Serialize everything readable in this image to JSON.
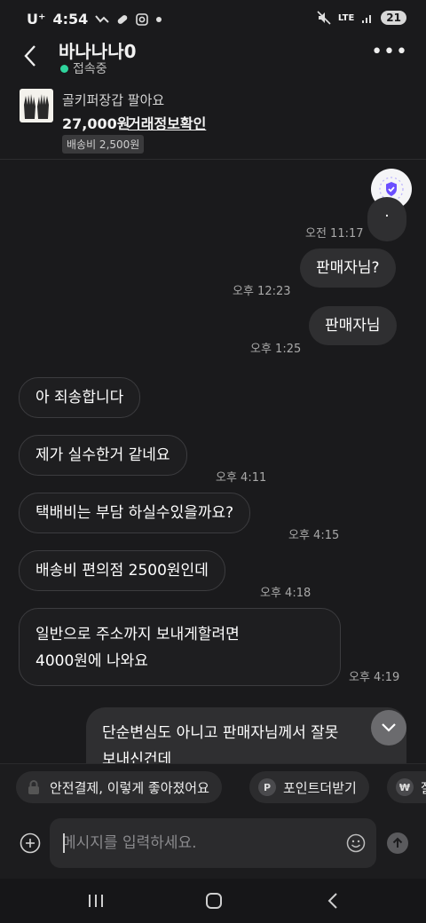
{
  "status_bar": {
    "carrier": "U⁺",
    "time": "4:54",
    "network": "LTE",
    "battery": "21"
  },
  "header": {
    "title": "바나나나0",
    "status": "접속중"
  },
  "product": {
    "name": "골키퍼장갑 팔아요",
    "price": "27,000원",
    "link": "거래정보확인",
    "shipping": "배송비 2,500원"
  },
  "messages": [
    {
      "side": "mine",
      "text": "·",
      "time": "오전 11:17"
    },
    {
      "side": "mine",
      "text": "판매자님?",
      "time": "오후 12:23"
    },
    {
      "side": "mine",
      "text": "판매자님",
      "time": "오후 1:25"
    },
    {
      "side": "theirs",
      "text": "아 죄송합니다",
      "time": ""
    },
    {
      "side": "theirs",
      "text": "제가 실수한거 같네요",
      "time": "오후 4:11"
    },
    {
      "side": "theirs",
      "text": "택배비는 부담 하실수있을까요?",
      "time": "오후 4:15"
    },
    {
      "side": "theirs",
      "text": "배송비 편의점 2500원인데",
      "time": "오후 4:18"
    },
    {
      "side": "theirs",
      "text_line1": "일반으로 주소까지 보내게할려면",
      "text_line2": "4000원에 나와요",
      "time": "오후 4:19"
    },
    {
      "side": "mine",
      "text_line1": "단순변심도 아니고 판매자님께서 잘못",
      "text_line2": "보내신건데"
    }
  ],
  "chips": [
    {
      "label": "안전결제, 이렇게 좋아졌어요",
      "icon": "lock-icon"
    },
    {
      "label": "포인트더받기",
      "icon": "P"
    },
    {
      "label": "잘",
      "icon": "₩"
    }
  ],
  "input": {
    "placeholder": "메시지를 입력하세요."
  },
  "colors": {
    "background": "#1a1a1c",
    "mine_bubble": "#2f2f31",
    "online": "#2fd49d",
    "shield": "#6b4eff"
  }
}
